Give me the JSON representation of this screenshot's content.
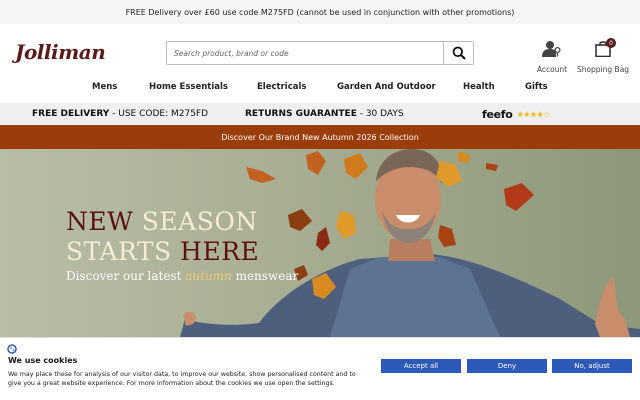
{
  "promo": {
    "text": "FREE Delivery over £60 use code M275FD (cannot be used in conjunction with other promotions)"
  },
  "header": {
    "logo": "Jolliman",
    "search_placeholder": "Search product, brand or code",
    "account_label": "Account",
    "bag_label": "Shopping Bag",
    "bag_count": "0"
  },
  "nav": {
    "items": [
      "Mens",
      "Home Essentials",
      "Electricals",
      "Garden And Outdoor",
      "Health",
      "Gifts"
    ]
  },
  "usp": {
    "delivery_bold": "FREE DELIVERY",
    "delivery_rest": " - USE CODE: M275FD",
    "returns_bold": "RETURNS GUARANTEE",
    "returns_rest": " - 30 DAYS",
    "feefo_logo": "feefo",
    "feefo_rating": "4.5 of 5"
  },
  "autumn_banner": {
    "text": "Discover Our Brand New Autumn 2026 Collection"
  },
  "hero": {
    "line1_word1": "NEW",
    "line1_word2": "SEASON",
    "line2_word1": "STARTS",
    "line2_word2": "HERE",
    "sub_before": "Discover our latest ",
    "sub_italic": "autumn",
    "sub_after": " menswear"
  },
  "cookie": {
    "title": "We use cookies",
    "text": "We may place these for analysis of our visitor data, to improve our website, show personalised content and to give you a great website experience. For more information about the cookies we use open the settings.",
    "accept": "Accept all",
    "deny": "Deny",
    "adjust": "No, adjust"
  },
  "colors": {
    "brand": "#5a1a1a",
    "autumn_bar": "#9a3d0a",
    "cookie_button": "#2d5ab8",
    "star": "#f0b400"
  },
  "icons": [
    "search-icon",
    "account-icon",
    "shopping-bag-icon",
    "cookie-icon",
    "star-icon"
  ]
}
